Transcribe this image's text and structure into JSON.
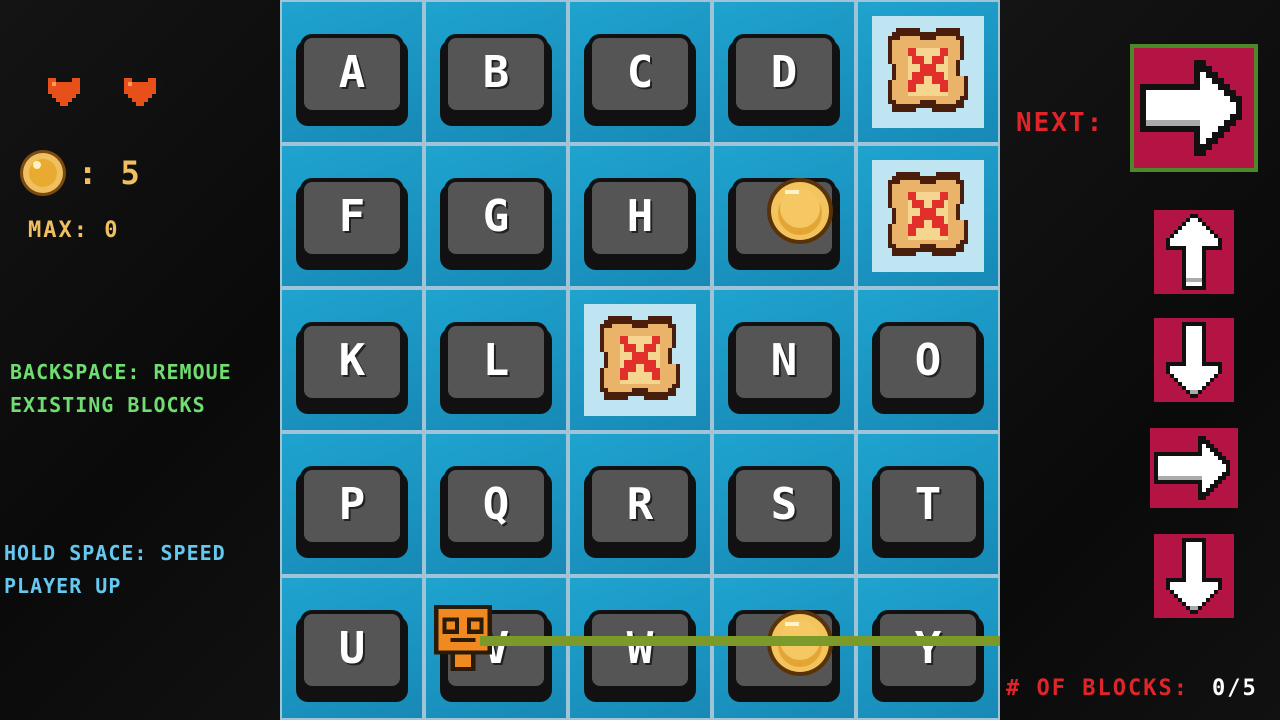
{
  "status": {
    "hearts": 2,
    "coin_count": ": 5",
    "max_label": "MAX: 0"
  },
  "hints": {
    "remove": "BACKSPACE: REMOUE\nEXISTING BLOCKS",
    "speed": "HOLD SPACE: SPEED\nPLAYER UP"
  },
  "grid": {
    "rows": [
      [
        "A",
        "B",
        "C",
        "D",
        "obstacle"
      ],
      [
        "F",
        "G",
        "H",
        "coin",
        "obstacle"
      ],
      [
        "K",
        "L",
        "obstacle",
        "N",
        "O"
      ],
      [
        "P",
        "Q",
        "R",
        "S",
        "T"
      ],
      [
        "U",
        "V",
        "W",
        "coin",
        "Y"
      ]
    ],
    "keys": {
      "A": "A",
      "B": "B",
      "C": "C",
      "D": "D",
      "F": "F",
      "G": "G",
      "H": "H",
      "K": "K",
      "L": "L",
      "N": "N",
      "O": "O",
      "P": "P",
      "Q": "Q",
      "R": "R",
      "S": "S",
      "T": "T",
      "U": "U",
      "V": "V",
      "W": "W",
      "Y": "Y"
    }
  },
  "queue": {
    "next_label": "NEXT:",
    "next_arrow": "right-arrow-icon",
    "upcoming": [
      "up-arrow-icon",
      "down-arrow-icon",
      "right-arrow-icon",
      "down-arrow-icon"
    ]
  },
  "blocks": {
    "label": "# OF BLOCKS:",
    "count": "0/5"
  },
  "colors": {
    "heart": "#e8501a",
    "coin": "#f0c060",
    "hint_green": "#6fdd6f",
    "hint_blue": "#64c8f0",
    "accent_red": "#e0252a",
    "arrow_bg": "#b31444",
    "next_border": "#4a8a2a",
    "cell": "#1fa3cf",
    "key": "#555555"
  }
}
